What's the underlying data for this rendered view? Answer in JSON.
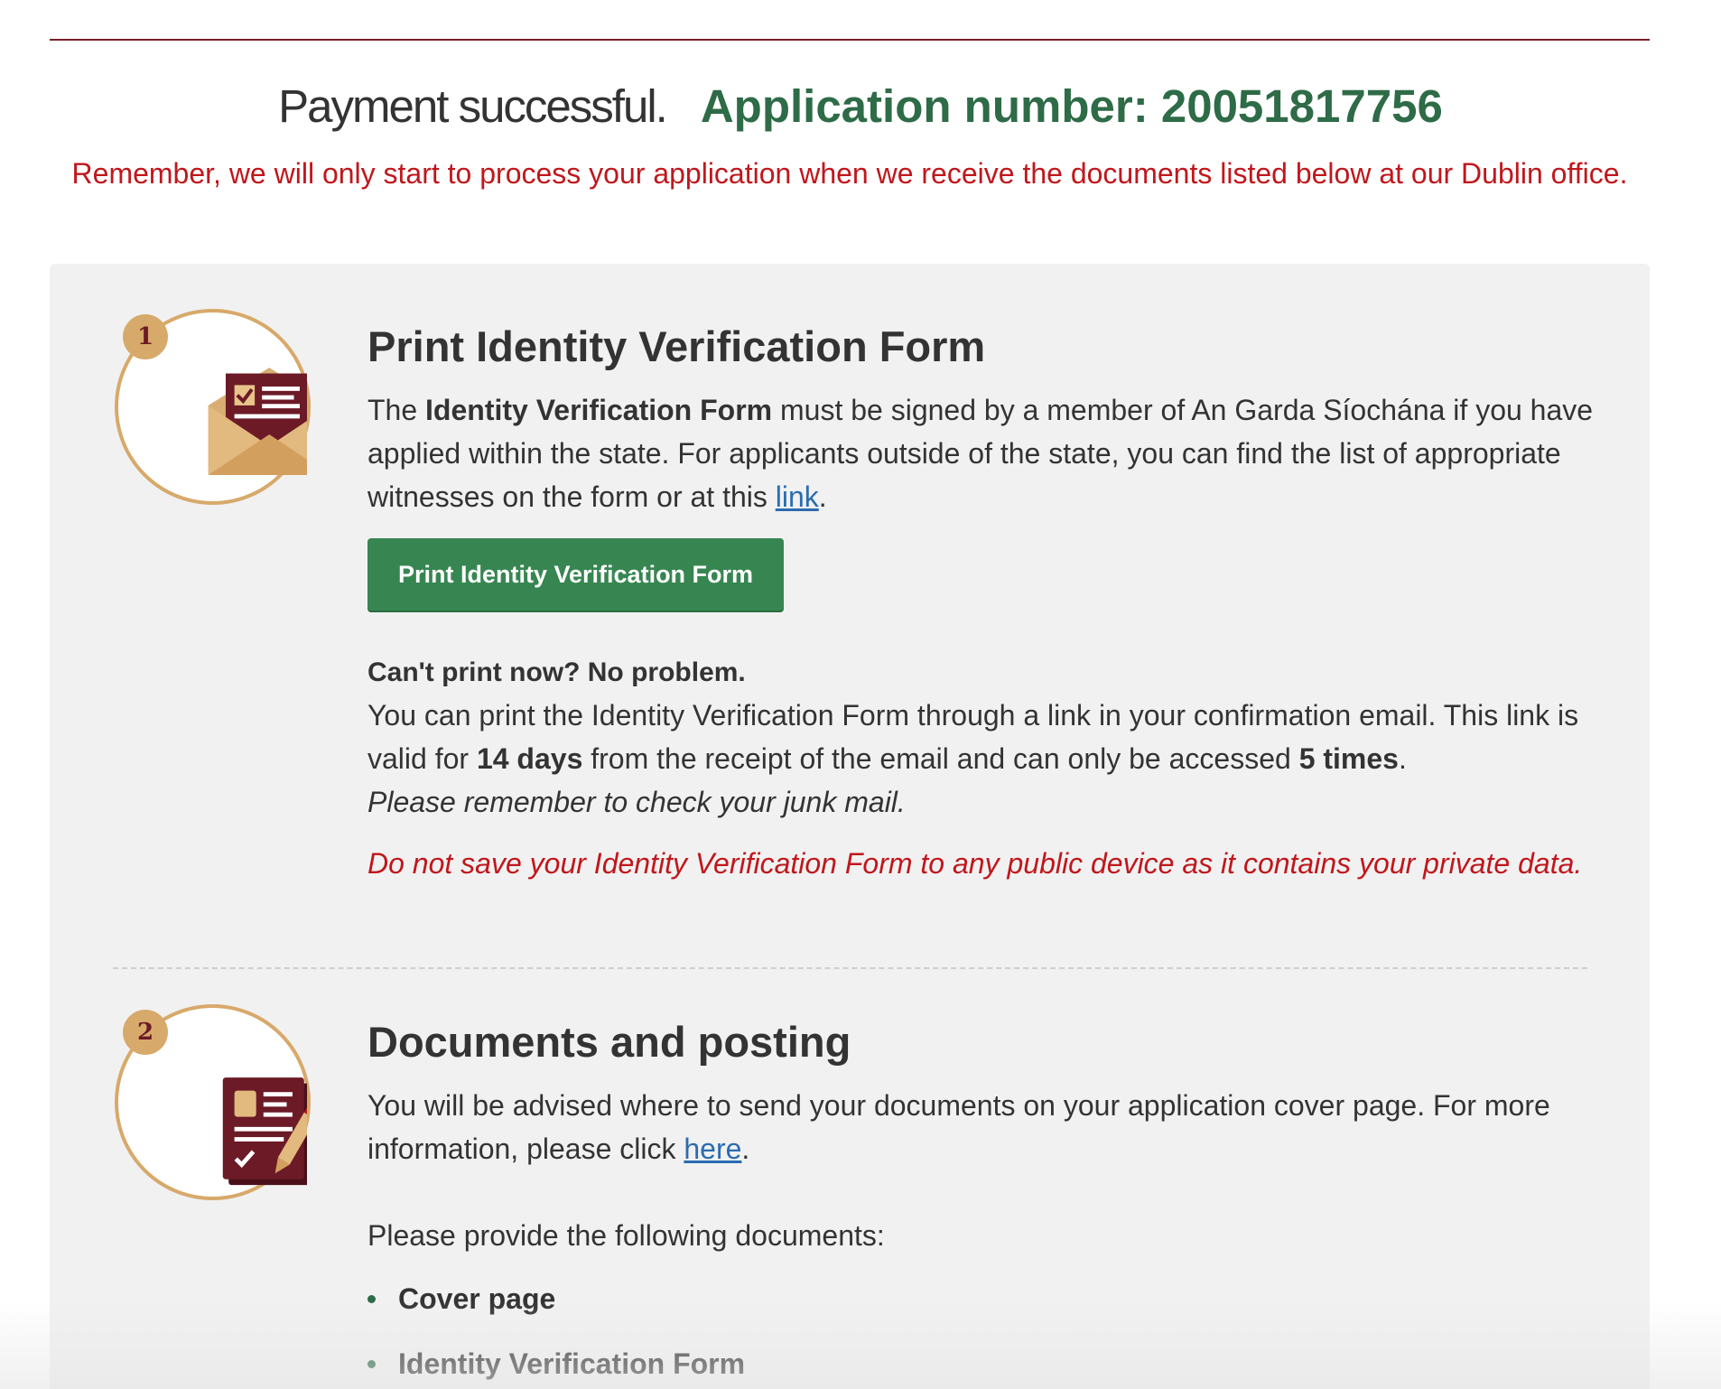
{
  "status": {
    "payment_text": "Payment successful.",
    "application_number_text": "Application number: 20051817756"
  },
  "reminder": "Remember, we will only start to process your application when we receive the documents listed below at our Dublin office.",
  "colors": {
    "accent_green": "#2e6b47",
    "button_green": "#378651",
    "warning_red": "#c0171c",
    "badge_gold": "#d7a96a",
    "icon_maroon": "#6b1a26"
  },
  "step1": {
    "number": "1",
    "icon": "envelope-form-icon",
    "title": "Print Identity Verification Form",
    "para_prefix": "The ",
    "para_bold": "Identity Verification Form",
    "para_rest": " must be signed by a member of An Garda Síochána if you have applied within the state. For applicants outside of the state, you can find the list of appropriate witnesses on the form or at this ",
    "link_text": "link",
    "para_end": ".",
    "button_label": "Print Identity Verification Form",
    "cant_print_heading": "Can't print now? No problem.",
    "email_text_1": "You can print the Identity Verification Form through a link in your confirmation email. This link is valid for ",
    "email_bold_days": "14 days",
    "email_text_2": " from the receipt of the email and can only be accessed ",
    "email_bold_times": "5 times",
    "email_text_3": ".",
    "junk_mail_note": "Please remember to check your junk mail.",
    "warning": "Do not save your Identity Verification Form to any public device as it contains your private data."
  },
  "step2": {
    "number": "2",
    "icon": "document-pencil-icon",
    "title": "Documents and posting",
    "para_text": "You will be advised where to send your documents on your application cover page. For more information, please click ",
    "link_text": "here",
    "para_end": ".",
    "provide_text": "Please provide the following documents:",
    "documents": [
      "Cover page",
      "Identity Verification Form"
    ]
  }
}
